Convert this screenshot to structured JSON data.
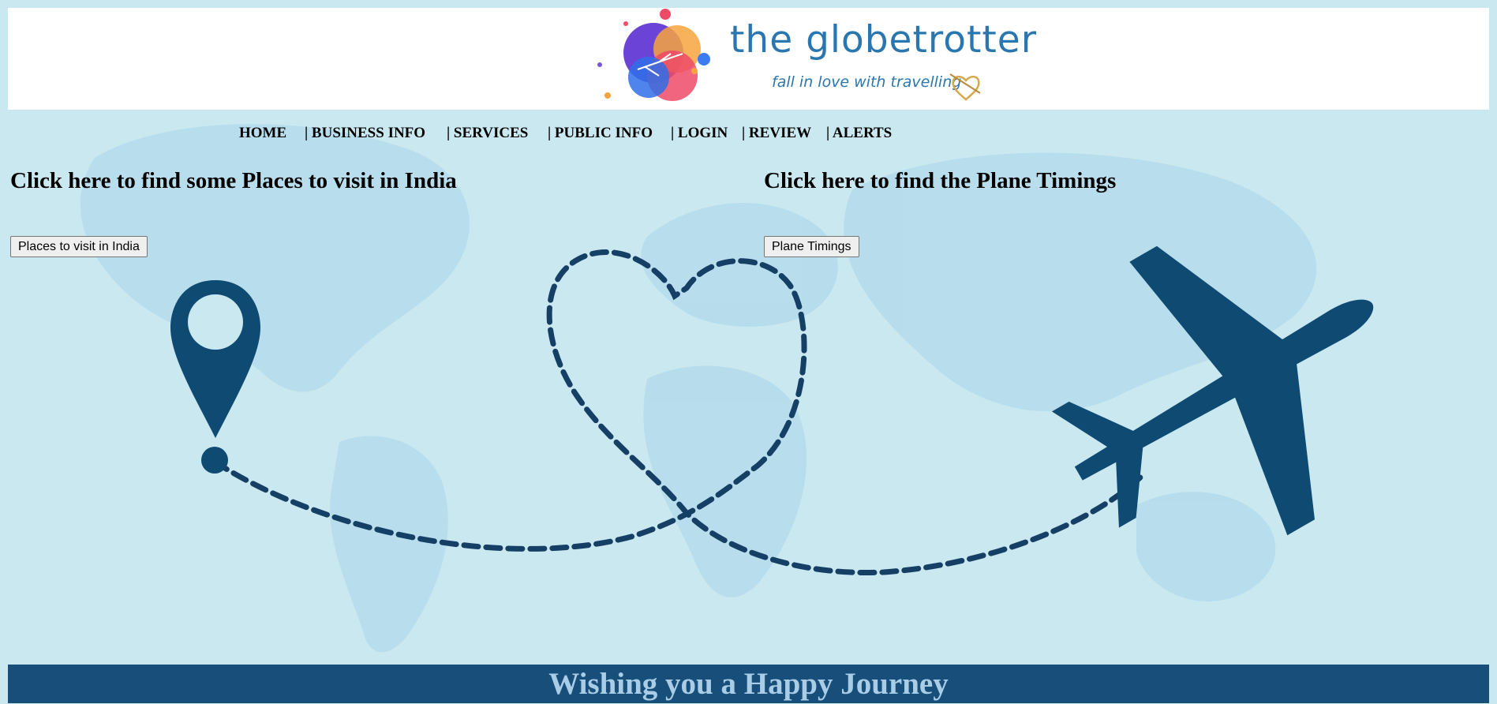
{
  "logo": {
    "title": "the globetrotter",
    "tagline": "fall in love with travelling"
  },
  "nav": {
    "items": [
      {
        "label": "HOME"
      },
      {
        "label": "| BUSINESS INFO"
      },
      {
        "label": "| SERVICES"
      },
      {
        "label": "| PUBLIC INFO"
      },
      {
        "label": "| LOGIN"
      },
      {
        "label": "| REVIEW"
      },
      {
        "label": "| ALERTS"
      }
    ]
  },
  "sections": {
    "places": {
      "heading": "Click here to find some Places to visit in India",
      "button_label": "Places to visit in India"
    },
    "planes": {
      "heading": "Click here to find the Plane Timings",
      "button_label": "Plane Timings"
    }
  },
  "footer": {
    "message": "Wishing you a Happy Journey"
  },
  "colors": {
    "background": "#c9e8f0",
    "map_land": "#b5dcec",
    "icon_navy": "#0f4a72",
    "footer_bg": "#184f7a",
    "footer_text": "#a9cde6",
    "logo_blue": "#2a77b0"
  },
  "icons": {
    "location_pin": "location-pin-icon",
    "airplane": "airplane-icon",
    "logo_mark": "globetrotter-logo-icon"
  }
}
